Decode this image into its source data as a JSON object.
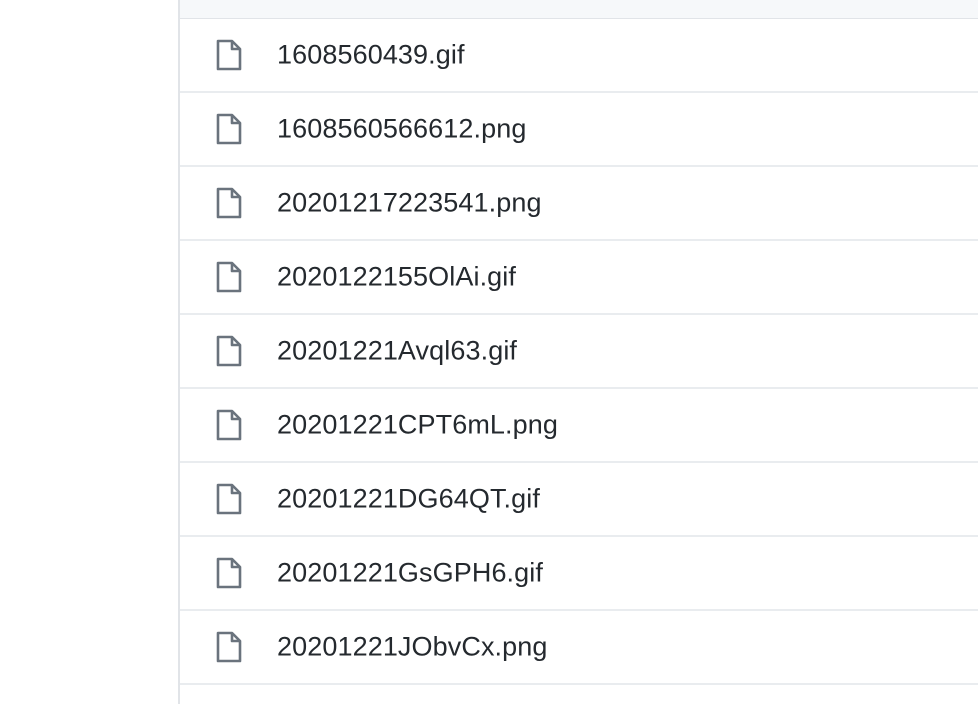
{
  "file_list": {
    "icon": "file-icon",
    "icon_color": "#6a737d",
    "text_color": "#24292e",
    "rows": [
      {
        "name": "1608560439.gif"
      },
      {
        "name": "1608560566612.png"
      },
      {
        "name": "20201217223541.png"
      },
      {
        "name": "2020122155OlAi.gif"
      },
      {
        "name": "20201221Avql63.gif"
      },
      {
        "name": "20201221CPT6mL.png"
      },
      {
        "name": "20201221DG64QT.gif"
      },
      {
        "name": "20201221GsGPH6.gif"
      },
      {
        "name": "20201221JObvCx.png"
      }
    ]
  }
}
